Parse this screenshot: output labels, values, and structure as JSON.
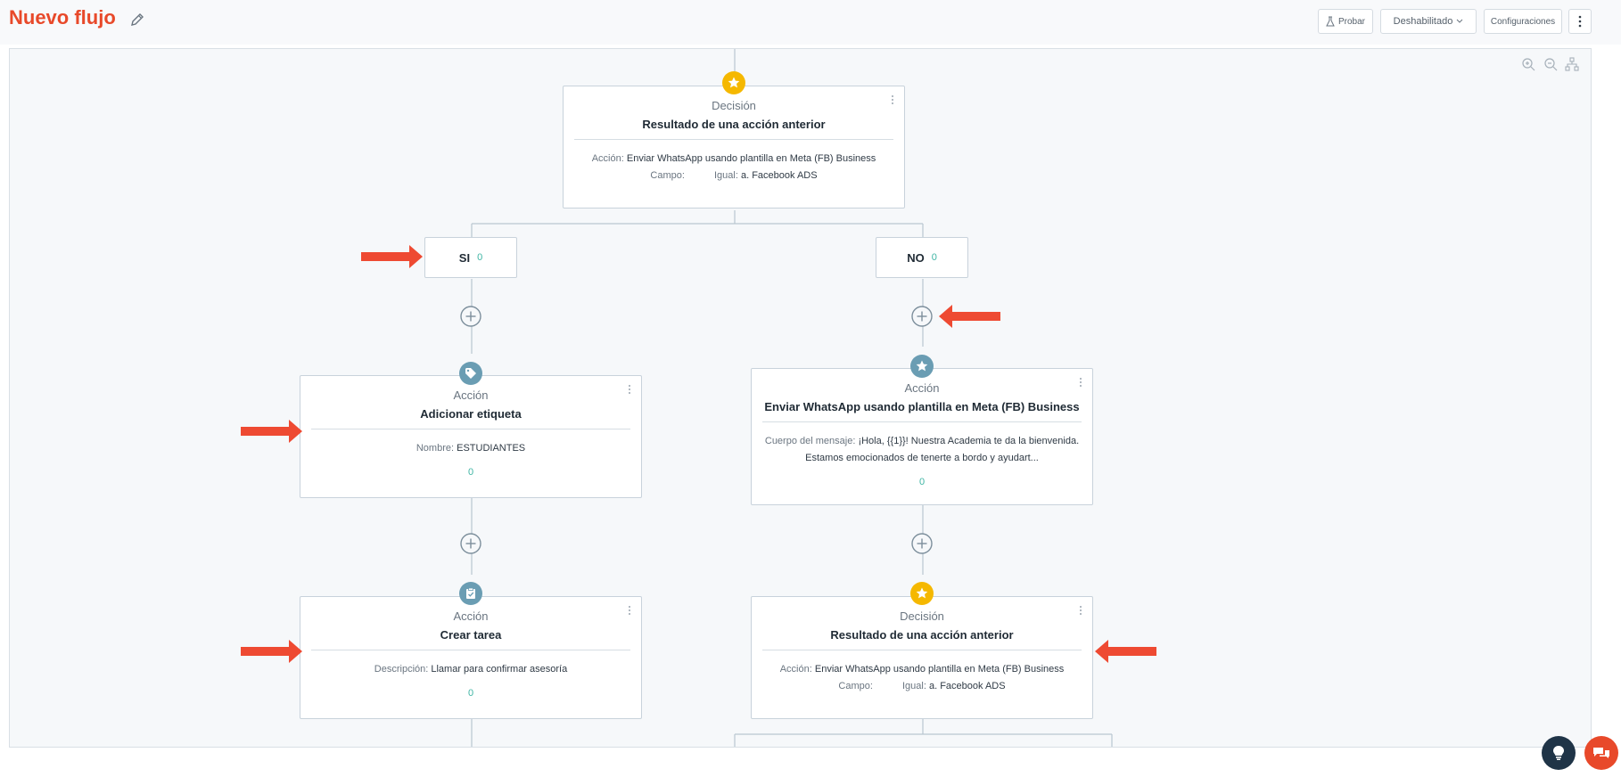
{
  "header": {
    "title": "Nuevo flujo",
    "probar_label": "Probar",
    "status_label": "Deshabilitado",
    "config_label": "Configuraciones"
  },
  "nodes": {
    "decision_top": {
      "kind": "Decisión",
      "name": "Resultado de una acción anterior",
      "accion_label": "Acción:",
      "accion_value": "Enviar WhatsApp usando plantilla en Meta (FB) Business",
      "campo_label": "Campo:",
      "igual_label": "Igual:",
      "igual_value": "a. Facebook ADS"
    },
    "branch_si": {
      "label": "SI",
      "count": "0"
    },
    "branch_no": {
      "label": "NO",
      "count": "0"
    },
    "accion_etiqueta": {
      "kind": "Acción",
      "name": "Adicionar etiqueta",
      "field_label": "Nombre:",
      "field_value": "ESTUDIANTES",
      "count": "0"
    },
    "accion_whatsapp": {
      "kind": "Acción",
      "name": "Enviar WhatsApp usando plantilla en Meta (FB) Business",
      "field_label": "Cuerpo del mensaje:",
      "field_value_line1": "¡Hola, {{1}}! Nuestra Academia te da la bienvenida.",
      "field_value_line2": "Estamos emocionados de tenerte a bordo y ayudart...",
      "count": "0"
    },
    "accion_tarea": {
      "kind": "Acción",
      "name": "Crear tarea",
      "field_label": "Descripción:",
      "field_value": "Llamar para confirmar asesoría",
      "count": "0"
    },
    "decision_bottom": {
      "kind": "Decisión",
      "name": "Resultado de una acción anterior",
      "accion_label": "Acción:",
      "accion_value": "Enviar WhatsApp usando plantilla en Meta (FB) Business",
      "campo_label": "Campo:",
      "igual_label": "Igual:",
      "igual_value": "a. Facebook ADS"
    }
  },
  "colors": {
    "brand": "#e8492a",
    "decision_badge": "#f5b800",
    "action_badge": "#6a9db3",
    "count": "#3fb5a4",
    "arrow": "#ee4a32",
    "help_fab": "#1f3447",
    "chat_fab": "#e8492a"
  },
  "icons": [
    "pencil-icon",
    "flask-icon",
    "chevron-down-icon",
    "kebab-menu-icon",
    "zoom-in-icon",
    "zoom-out-icon",
    "hierarchy-icon",
    "star-icon",
    "tag-icon",
    "clipboard-check-icon",
    "plus-circle-icon",
    "lightbulb-icon",
    "chat-icon"
  ]
}
